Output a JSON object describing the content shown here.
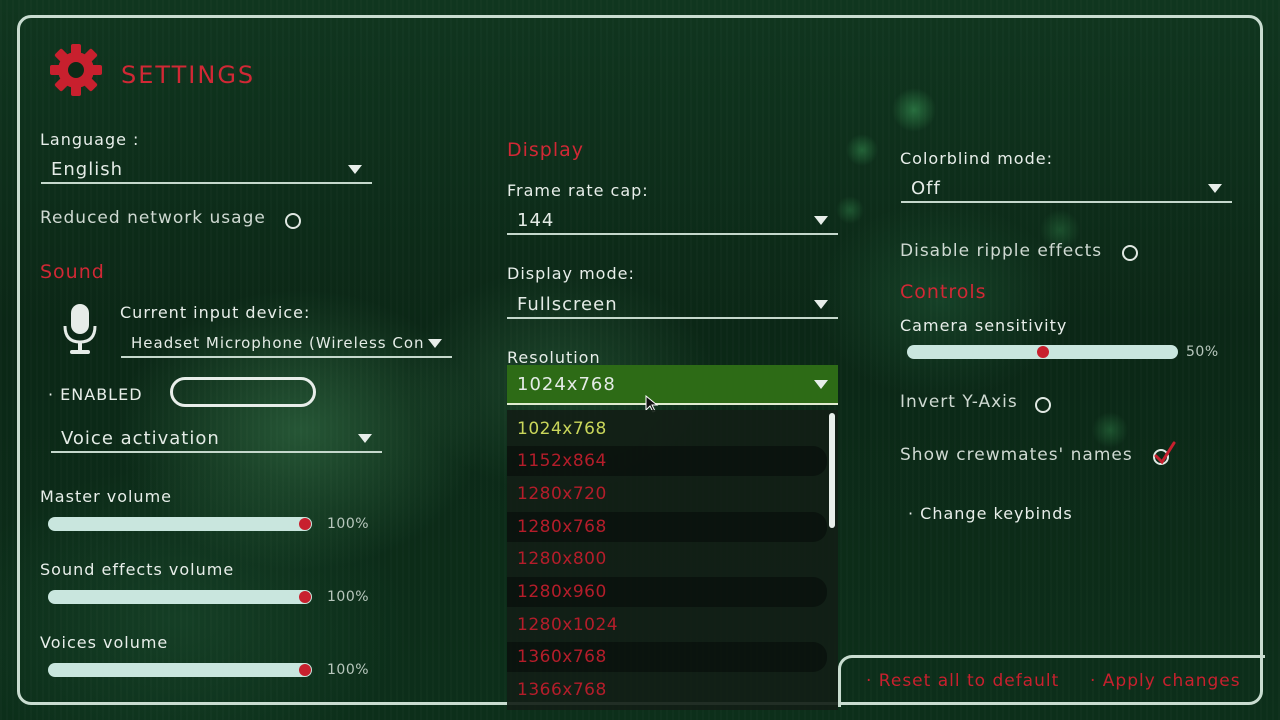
{
  "header": {
    "title": "SETTINGS",
    "icon": "gear-icon",
    "accent": "#c8202e"
  },
  "general": {
    "language_label": "Language :",
    "language_value": "English",
    "reduced_network_label": "Reduced network usage"
  },
  "sound": {
    "heading": "Sound",
    "input_device_label": "Current input device:",
    "input_device_value": "Headset Microphone (Wireless Con",
    "enabled_label": "· ENABLED",
    "voice_mode_value": "Voice activation",
    "master": {
      "label": "Master volume",
      "value": "100%",
      "level": 1.0
    },
    "sfx": {
      "label": "Sound effects volume",
      "value": "100%",
      "level": 1.0
    },
    "voices": {
      "label": "Voices volume",
      "value": "100%",
      "level": 1.0
    }
  },
  "display": {
    "heading": "Display",
    "frame_rate_label": "Frame rate cap:",
    "frame_rate_value": "144",
    "display_mode_label": "Display mode:",
    "display_mode_value": "Fullscreen",
    "resolution_label": "Resolution",
    "resolution_value": "1024x768",
    "resolution_options": [
      "1024x768",
      "1152x864",
      "1280x720",
      "1280x768",
      "1280x800",
      "1280x960",
      "1280x1024",
      "1360x768",
      "1366x768"
    ]
  },
  "accessibility": {
    "colorblind_label": "Colorblind mode:",
    "colorblind_value": "Off",
    "ripple_label": "Disable ripple effects"
  },
  "controls": {
    "heading": "Controls",
    "camera_label": "Camera sensitivity",
    "camera_value": "50%",
    "camera_level": 0.5,
    "invert_label": "Invert Y-Axis",
    "names_label": "Show crewmates' names",
    "keybinds_label": "· Change keybinds"
  },
  "footer": {
    "reset_label": "· Reset all to default",
    "apply_label": "· Apply changes"
  }
}
